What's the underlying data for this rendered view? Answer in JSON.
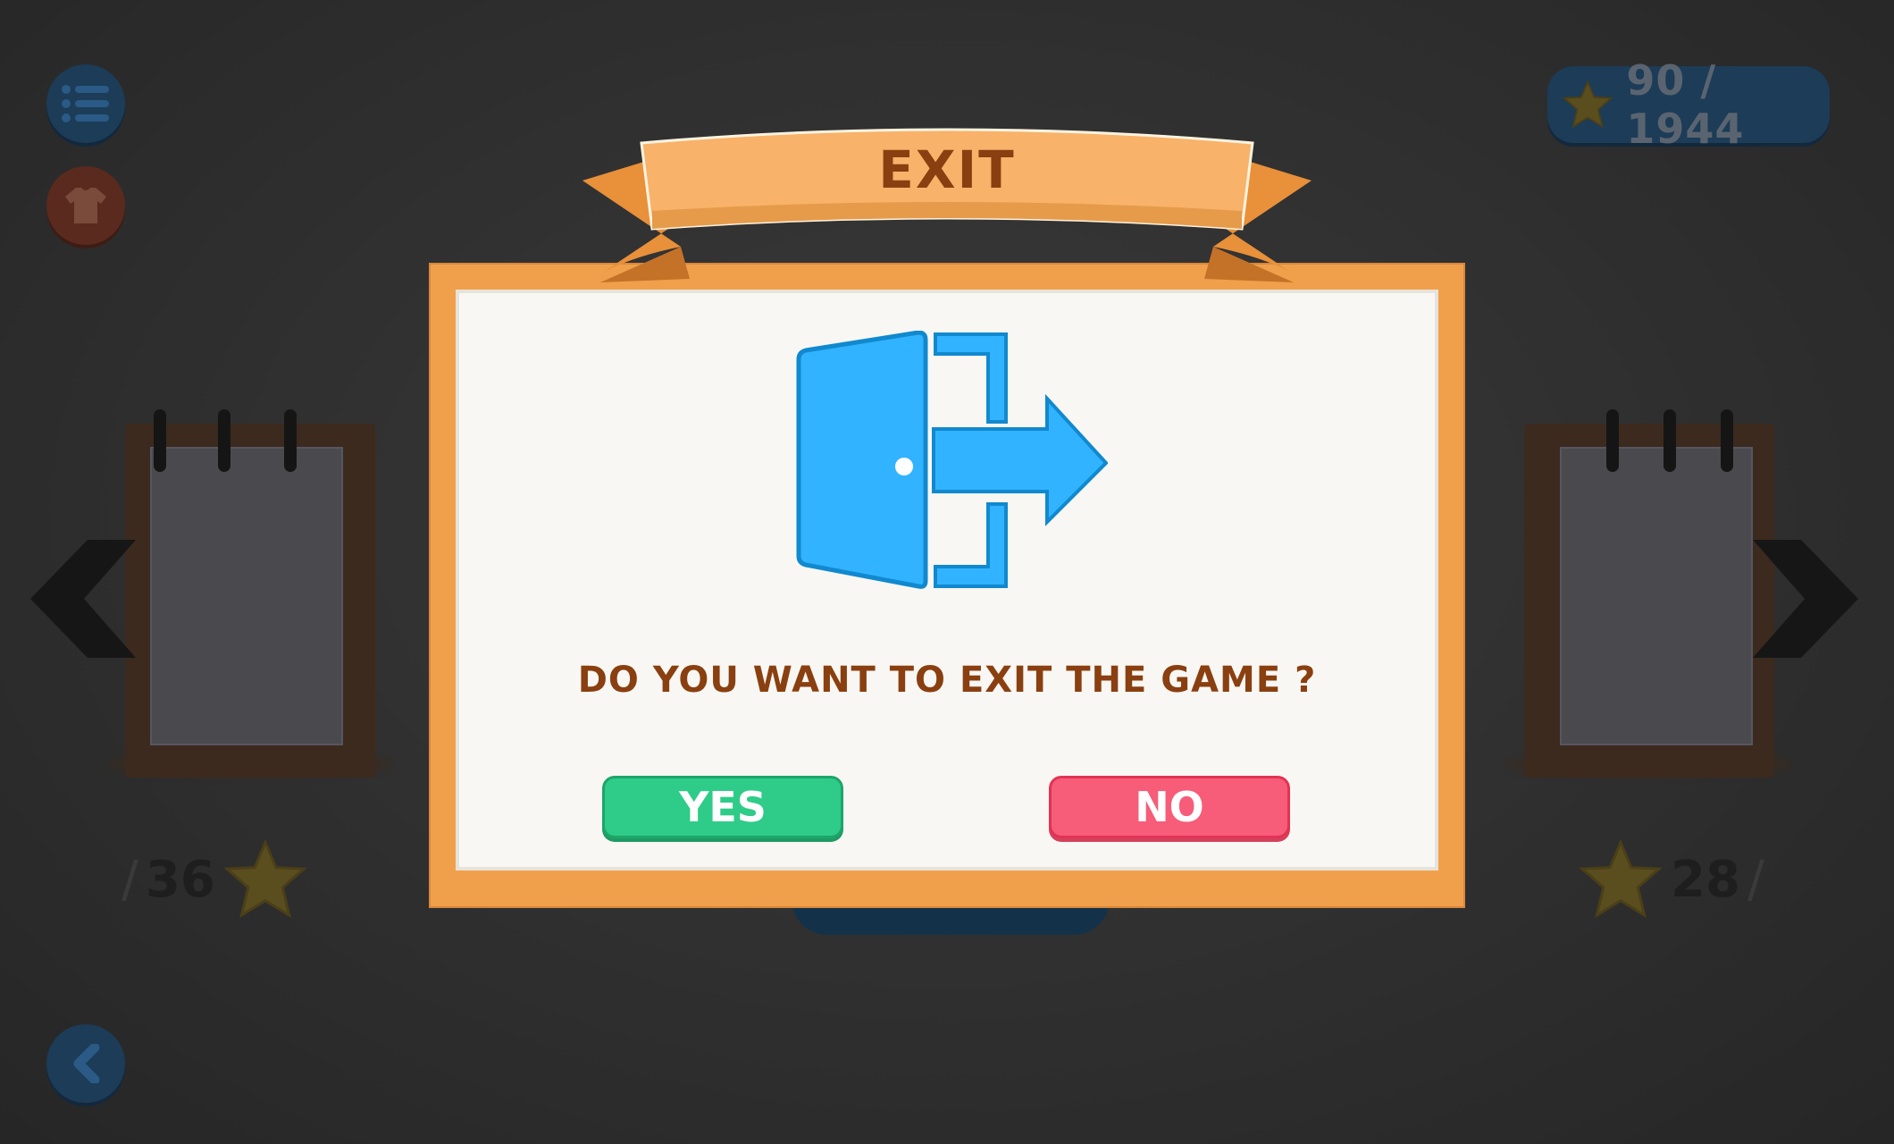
{
  "dialog": {
    "title": "EXIT",
    "question": "DO YOU WANT TO EXIT THE GAME ?",
    "yes_label": "YES",
    "no_label": "NO"
  },
  "hud": {
    "stars_total": "90 / 1944"
  },
  "levels": {
    "left_score": "36",
    "right_score": "28",
    "slash": "/"
  },
  "icons": {
    "menu": "menu-icon",
    "shirt": "shirt-icon",
    "back": "back-arrow-icon",
    "star": "star-icon",
    "exit": "exit-door-icon"
  },
  "colors": {
    "dialog_frame": "#f0a04a",
    "title_text": "#8a3f10",
    "yes_button": "#2ecc88",
    "no_button": "#f75c78",
    "exit_icon": "#32b3ff"
  }
}
